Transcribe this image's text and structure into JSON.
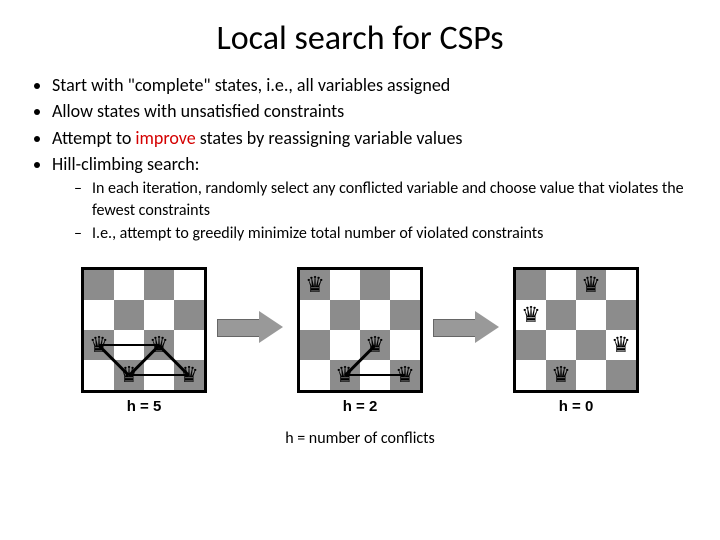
{
  "title": "Local search for CSPs",
  "bullets": {
    "b1": "Start with \"complete\" states, i.e., all variables assigned",
    "b2": "Allow states with unsatisfied constraints",
    "b3_a": "Attempt to ",
    "b3_improve": "improve",
    "b3_b": " states by reassigning variable values",
    "b4": "Hill-climbing search:",
    "sub1": "In each iteration, randomly select any conflicted variable and choose value that violates the fewest constraints",
    "sub2": "I.e., attempt to greedily minimize total number of violated constraints"
  },
  "boards": [
    {
      "queens": [
        [
          2,
          0
        ],
        [
          3,
          1
        ],
        [
          2,
          2
        ],
        [
          3,
          3
        ]
      ],
      "conflicts": [
        {
          "from": [
            2,
            0
          ],
          "to": [
            2,
            2
          ]
        },
        {
          "from": [
            2,
            0
          ],
          "to": [
            3,
            1
          ]
        },
        {
          "from": [
            3,
            1
          ],
          "to": [
            2,
            2
          ]
        },
        {
          "from": [
            3,
            1
          ],
          "to": [
            3,
            3
          ]
        },
        {
          "from": [
            2,
            2
          ],
          "to": [
            3,
            3
          ]
        }
      ],
      "label": "h = 5"
    },
    {
      "queens": [
        [
          0,
          0
        ],
        [
          3,
          1
        ],
        [
          2,
          2
        ],
        [
          3,
          3
        ]
      ],
      "conflicts": [
        {
          "from": [
            3,
            1
          ],
          "to": [
            2,
            2
          ]
        },
        {
          "from": [
            3,
            1
          ],
          "to": [
            3,
            3
          ]
        }
      ],
      "label": "h = 2"
    },
    {
      "queens": [
        [
          1,
          0
        ],
        [
          3,
          1
        ],
        [
          0,
          2
        ],
        [
          2,
          3
        ]
      ],
      "conflicts": [],
      "label": "h = 0"
    }
  ],
  "caption": "h = number of conflicts",
  "glyph": "♛"
}
